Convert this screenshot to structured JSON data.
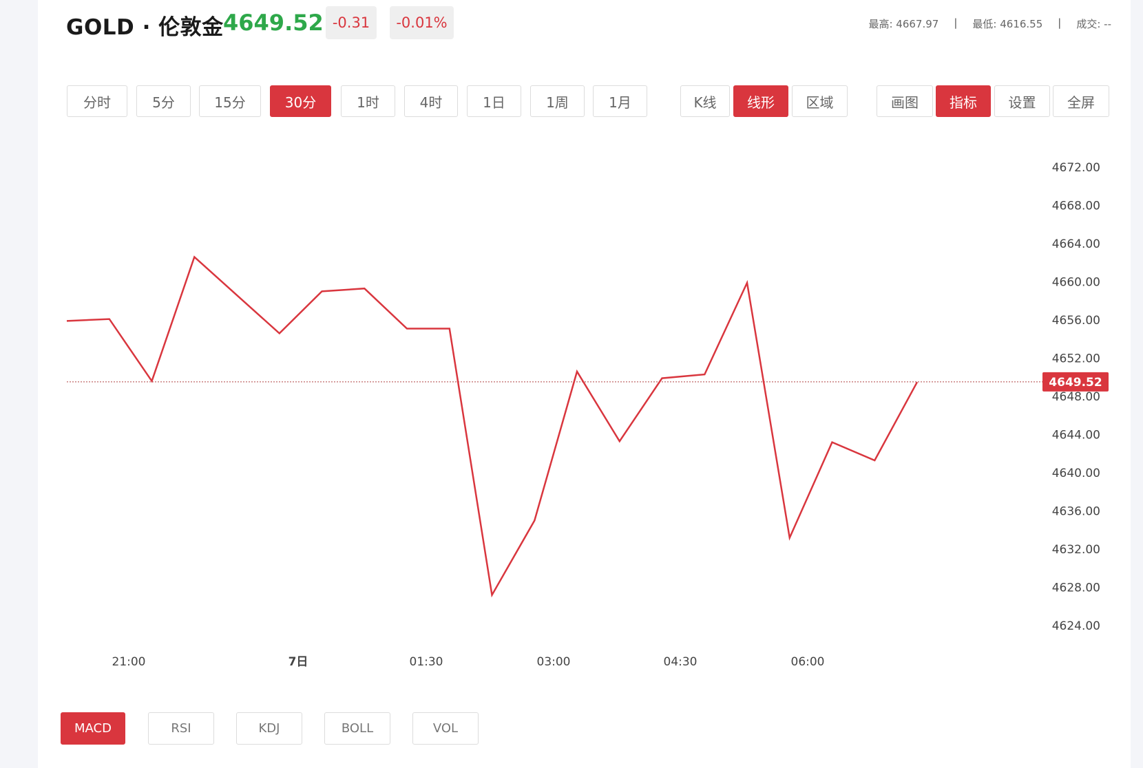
{
  "header": {
    "symbol": "GOLD · 伦敦金",
    "price": "4649.52",
    "change": "-0.31",
    "change_pct": "-0.01%",
    "high_label": "最高:",
    "high_value": "4667.97",
    "low_label": "最低:",
    "low_value": "4616.55",
    "volume_label": "成交:",
    "volume_value": "--",
    "separator": "|"
  },
  "colors": {
    "accent": "#d9363e",
    "up_price": "#2ea84a",
    "line": "#d9363e"
  },
  "periods": [
    "分时",
    "5分",
    "15分",
    "30分",
    "1时",
    "4时",
    "1日",
    "1周",
    "1月"
  ],
  "active_period": "30分",
  "chart_types": [
    "K线",
    "线形",
    "区域"
  ],
  "active_chart_type": "线形",
  "tools": [
    "画图",
    "指标",
    "设置",
    "全屏"
  ],
  "active_tool": "指标",
  "indicators": [
    "MACD",
    "RSI",
    "KDJ",
    "BOLL",
    "VOL"
  ],
  "active_indicator": "MACD",
  "chart_data": {
    "type": "line",
    "y_ticks": [
      "4672.00",
      "4668.00",
      "4664.00",
      "4660.00",
      "4656.00",
      "4652.00",
      "4648.00",
      "4644.00",
      "4640.00",
      "4636.00",
      "4632.00",
      "4628.00",
      "4624.00"
    ],
    "x_labels": [
      "21:00",
      "7日",
      "01:30",
      "03:00",
      "04:30",
      "06:00"
    ],
    "x_label_bold": "7日",
    "ylim": [
      4624,
      4672
    ],
    "current_price": 4649.52,
    "current_price_label": "4649.52",
    "series": [
      {
        "values": [
          4655.9,
          4656.1,
          4649.6,
          4662.6,
          4658.6,
          4654.6,
          4659.0,
          4659.3,
          4655.1,
          4655.1,
          4627.2,
          4635.0,
          4650.6,
          4643.3,
          4649.9,
          4650.3,
          4659.9,
          4633.2,
          4643.2,
          4641.3,
          4649.5
        ]
      }
    ]
  }
}
